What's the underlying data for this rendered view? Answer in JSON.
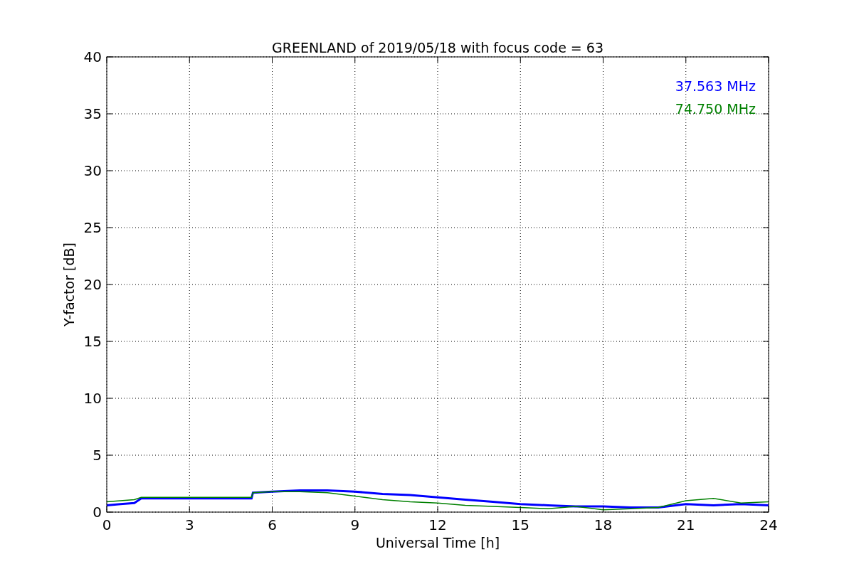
{
  "figure": {
    "chart_data": {
      "type": "line",
      "title": "GREENLAND of 2019/05/18 with focus code = 63",
      "xlabel": "Universal Time [h]",
      "ylabel": "Y-factor [dB]",
      "x": [
        0,
        0.5,
        1,
        1.25,
        5.25,
        5.3,
        6,
        7,
        8,
        9,
        10,
        11,
        12,
        13,
        14,
        15,
        16,
        17,
        18,
        19,
        20,
        21,
        22,
        23,
        24
      ],
      "xlim": [
        0,
        24
      ],
      "ylim": [
        0,
        40
      ],
      "xticks": [
        0,
        3,
        6,
        9,
        12,
        15,
        18,
        21,
        24
      ],
      "yticks": [
        0,
        5,
        10,
        15,
        20,
        25,
        30,
        35,
        40
      ],
      "grid": true,
      "series": [
        {
          "name": "37.563 MHz",
          "color": "#0000ff",
          "values": [
            0.6,
            0.7,
            0.8,
            1.2,
            1.2,
            1.7,
            1.8,
            1.9,
            1.9,
            1.8,
            1.6,
            1.5,
            1.3,
            1.1,
            0.9,
            0.7,
            0.6,
            0.5,
            0.5,
            0.4,
            0.4,
            0.7,
            0.6,
            0.7,
            0.6
          ]
        },
        {
          "name": "74.750 MHz",
          "color": "#008000",
          "values": [
            0.9,
            1.0,
            1.1,
            1.3,
            1.3,
            1.7,
            1.8,
            1.8,
            1.7,
            1.4,
            1.1,
            0.9,
            0.8,
            0.6,
            0.5,
            0.4,
            0.3,
            0.5,
            0.2,
            0.3,
            0.4,
            1.0,
            1.2,
            0.8,
            0.9
          ]
        }
      ]
    }
  }
}
